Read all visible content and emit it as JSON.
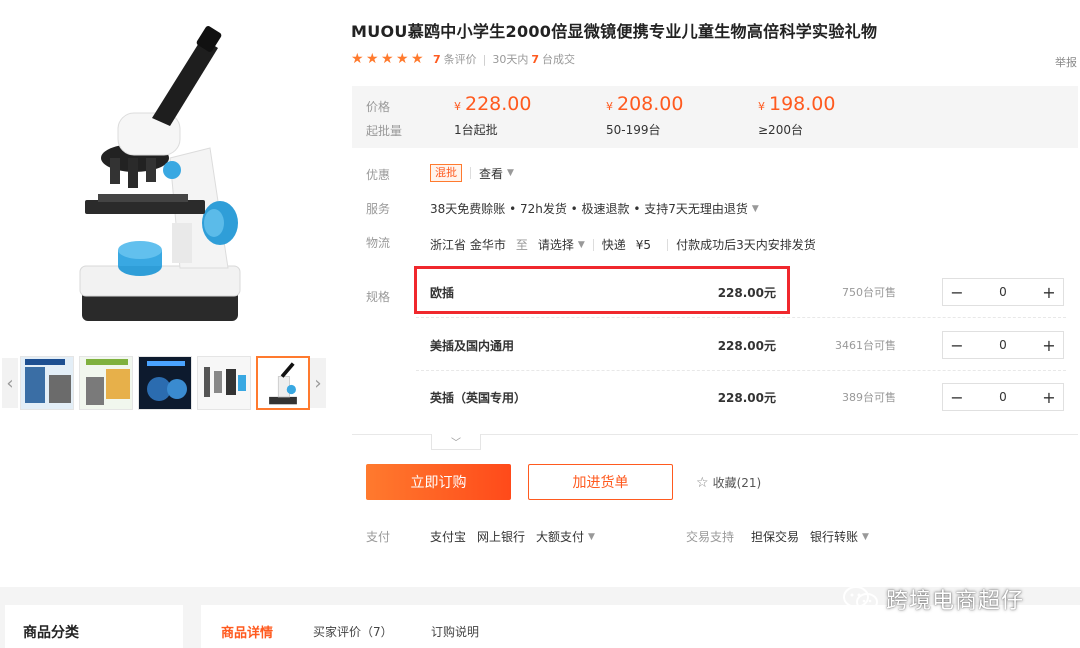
{
  "product": {
    "title": "MUOU慕鸥中小学生2000倍显微镜便携专业儿童生物高倍科学实验礼物",
    "rating_stars": 5,
    "review_count": "7",
    "review_label": "条评价",
    "deal_prefix": "30天内",
    "deal_count": "7",
    "deal_label": "台成交",
    "report": "举报"
  },
  "price_box": {
    "price_label": "价格",
    "qty_label": "起批量",
    "tiers": [
      {
        "currency": "¥",
        "price": "228.00",
        "qty": "1台起批"
      },
      {
        "currency": "¥",
        "price": "208.00",
        "qty": "50-199台"
      },
      {
        "currency": "¥",
        "price": "198.00",
        "qty": "≥200台"
      }
    ]
  },
  "rows": {
    "promo_label": "优惠",
    "promo_tag": "混批",
    "promo_view": "查看",
    "service_label": "服务",
    "service_text": "38天免费赊账 • 72h发货 • 极速退款 • 支持7天无理由退货",
    "logistics_label": "物流",
    "origin": "浙江省 金华市",
    "to": "至",
    "destination": "请选择",
    "express": "快递",
    "fee": "¥5",
    "ship_note": "付款成功后3天内安排发货",
    "spec_label": "规格"
  },
  "specs": [
    {
      "name": "欧插",
      "price": "228.00元",
      "stock": "750台可售",
      "qty": "0"
    },
    {
      "name": "美插及国内通用",
      "price": "228.00元",
      "stock": "3461台可售",
      "qty": "0"
    },
    {
      "name": "英插（英国专用）",
      "price": "228.00元",
      "stock": "389台可售",
      "qty": "0"
    }
  ],
  "stepper": {
    "minus": "−",
    "plus": "+"
  },
  "actions": {
    "buy": "立即订购",
    "cart": "加进货单",
    "favorite": "收藏(21)"
  },
  "payment": {
    "label": "支付",
    "methods": [
      "支付宝",
      "网上银行",
      "大额支付"
    ],
    "trade_label": "交易支持",
    "trade_methods": [
      "担保交易",
      "银行转账"
    ]
  },
  "bottom": {
    "category_title": "商品分类",
    "tabs": [
      "商品详情",
      "买家评价（7）",
      "订购说明"
    ]
  },
  "watermark": "跨境电商超仔",
  "colors": {
    "accent": "#ff5a1f",
    "highlight": "#f0282d"
  }
}
